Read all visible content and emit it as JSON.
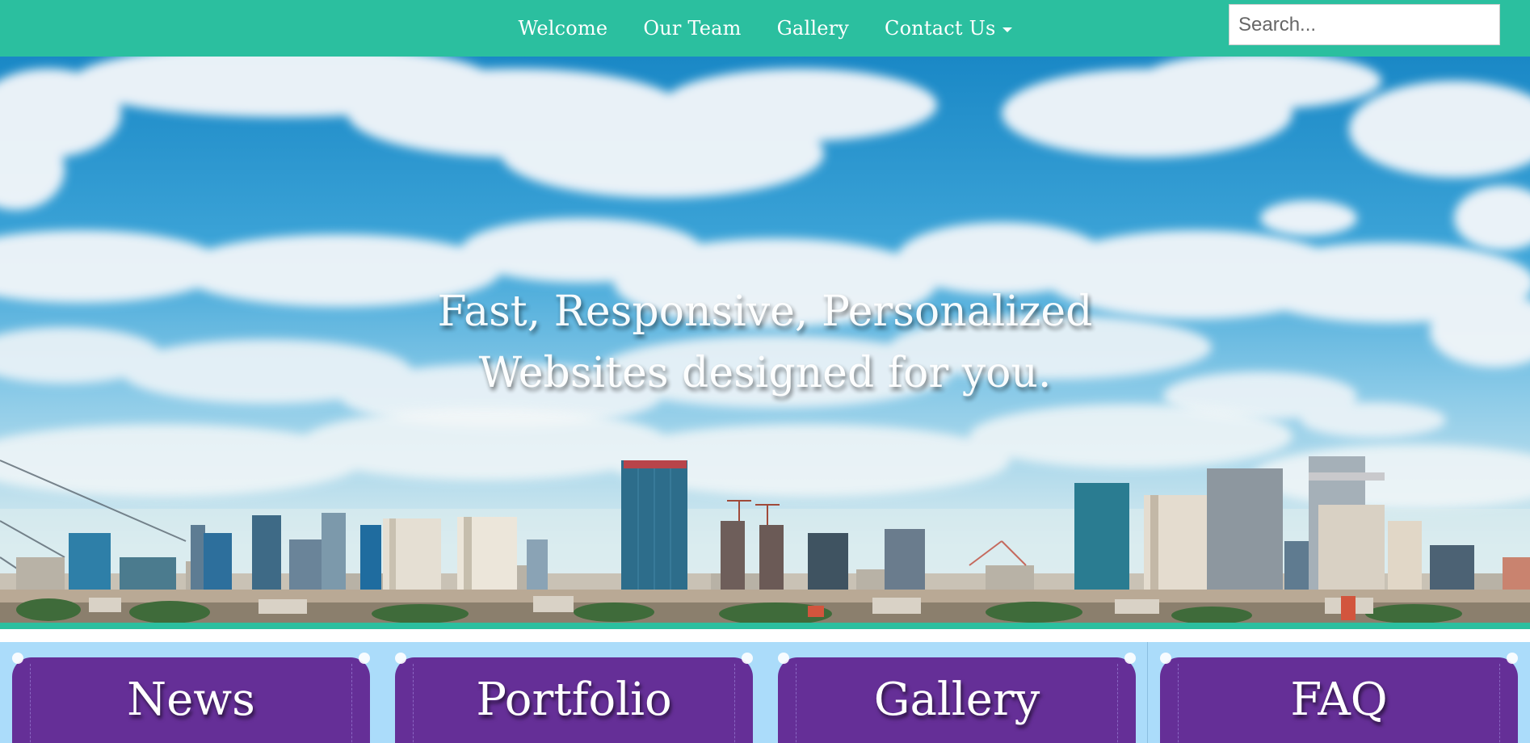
{
  "nav": {
    "links": [
      {
        "label": "Welcome"
      },
      {
        "label": "Our Team"
      },
      {
        "label": "Gallery"
      },
      {
        "label": "Contact Us"
      }
    ],
    "search_placeholder": "Search..."
  },
  "hero": {
    "headline_line1": "Fast, Responsive, Personalized",
    "headline_line2": "Websites designed for you.",
    "background": "city-skyline-under-cloudy-sky-photo"
  },
  "tiles": [
    {
      "label": "News"
    },
    {
      "label": "Portfolio"
    },
    {
      "label": "Gallery"
    },
    {
      "label": "FAQ"
    }
  ],
  "colors": {
    "navbar": "#2bbf9f",
    "tile": "#652f97",
    "tiles_background": "#abdcfa",
    "sky": "#1c8bc6"
  }
}
